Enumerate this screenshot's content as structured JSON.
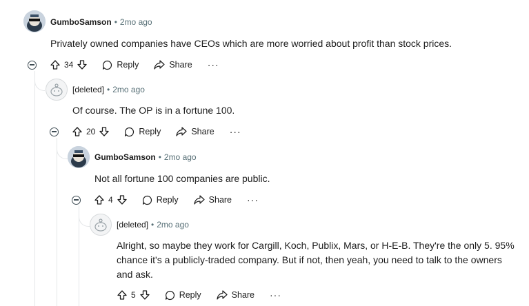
{
  "comments": [
    {
      "author": "GumboSamson",
      "time": "2mo ago",
      "text": "Privately owned companies have CEOs which are more worried about profit than stock prices.",
      "votes": "34",
      "reply": "Reply",
      "share": "Share",
      "more": "···"
    },
    {
      "author": "[deleted]",
      "time": "2mo ago",
      "text": "Of course. The OP is in a fortune 100.",
      "votes": "20",
      "reply": "Reply",
      "share": "Share",
      "more": "···"
    },
    {
      "author": "GumboSamson",
      "time": "2mo ago",
      "text": "Not all fortune 100 companies are public.",
      "votes": "4",
      "reply": "Reply",
      "share": "Share",
      "more": "···"
    },
    {
      "author": "[deleted]",
      "time": "2mo ago",
      "text_lines": [
        "Alright, so maybe they work for Cargill, Koch, Publix, Mars, or H-E-B. They're the only 5. 95%",
        "chance it's a publicly-traded company. But if not, then yeah, you need to talk to the owners",
        "and ask."
      ],
      "votes": "5",
      "reply": "Reply",
      "share": "Share",
      "more": "···"
    }
  ],
  "separator": "•"
}
